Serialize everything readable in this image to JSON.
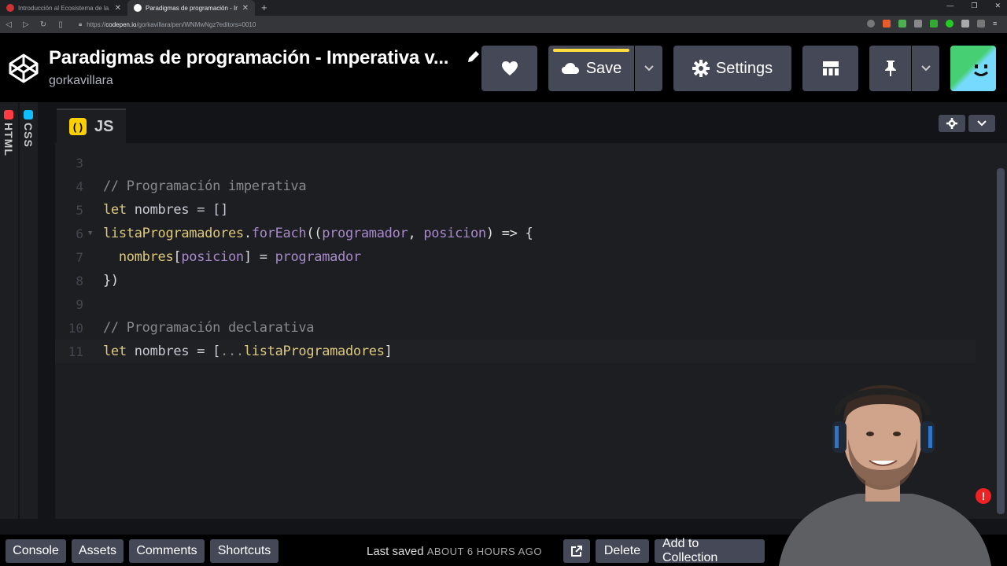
{
  "browser": {
    "tabs": [
      {
        "title": "Introducción al Ecosistema de la Prog",
        "active": false
      },
      {
        "title": "Paradigmas de programación - Im",
        "active": true
      }
    ],
    "url_prefix": "https://",
    "url_host": "codepen.io",
    "url_path": "/gorkavillara/pen/WNMwNgz?editors=0010"
  },
  "header": {
    "title": "Paradigmas de programación - Imperativa v...",
    "author": "gorkavillara",
    "save_label": "Save",
    "settings_label": "Settings"
  },
  "sidebar": {
    "html_label": "HTML",
    "css_label": "CSS"
  },
  "editor": {
    "tab_label": "JS",
    "tab_icon_glyph": "( )",
    "lines": [
      {
        "n": "3",
        "tokens": []
      },
      {
        "n": "4",
        "tokens": [
          {
            "t": "// Programación imperativa",
            "c": "comment"
          }
        ]
      },
      {
        "n": "5",
        "tokens": [
          {
            "t": "let",
            "c": "kw"
          },
          {
            "t": " nombres = []",
            "c": "var"
          }
        ]
      },
      {
        "n": "6",
        "fold": true,
        "tokens": [
          {
            "t": "listaProgramadores",
            "c": "kw"
          },
          {
            "t": ".",
            "c": "op"
          },
          {
            "t": "forEach",
            "c": "fn"
          },
          {
            "t": "((",
            "c": "op"
          },
          {
            "t": "programador",
            "c": "fn"
          },
          {
            "t": ", ",
            "c": "op"
          },
          {
            "t": "posicion",
            "c": "fn"
          },
          {
            "t": ") => {",
            "c": "op"
          }
        ]
      },
      {
        "n": "7",
        "tokens": [
          {
            "t": "  nombres",
            "c": "kw"
          },
          {
            "t": "[",
            "c": "op"
          },
          {
            "t": "posicion",
            "c": "fn"
          },
          {
            "t": "] = ",
            "c": "op"
          },
          {
            "t": "programador",
            "c": "fn"
          }
        ]
      },
      {
        "n": "8",
        "tokens": [
          {
            "t": "})",
            "c": "op"
          }
        ]
      },
      {
        "n": "9",
        "tokens": []
      },
      {
        "n": "10",
        "tokens": [
          {
            "t": "// Programación declarativa",
            "c": "comment"
          }
        ]
      },
      {
        "n": "11",
        "active": true,
        "tokens": [
          {
            "t": "let",
            "c": "kw"
          },
          {
            "t": " nombres = [",
            "c": "var"
          },
          {
            "t": "...",
            "c": "comment"
          },
          {
            "t": "listaProgramadores",
            "c": "kw"
          },
          {
            "t": "]",
            "c": "op"
          }
        ]
      }
    ]
  },
  "footer": {
    "console_label": "Console",
    "assets_label": "Assets",
    "comments_label": "Comments",
    "shortcuts_label": "Shortcuts",
    "last_saved_label": "Last saved",
    "last_saved_time": "ABOUT 6 HOURS AGO",
    "delete_label": "Delete",
    "collection_label": "Add to Collection"
  },
  "colors": {
    "accent_save": "#ffdd40",
    "button_bg": "#444857",
    "js_icon": "#fcd000",
    "html_icon": "#ff3c41",
    "css_icon": "#0ebeff"
  }
}
